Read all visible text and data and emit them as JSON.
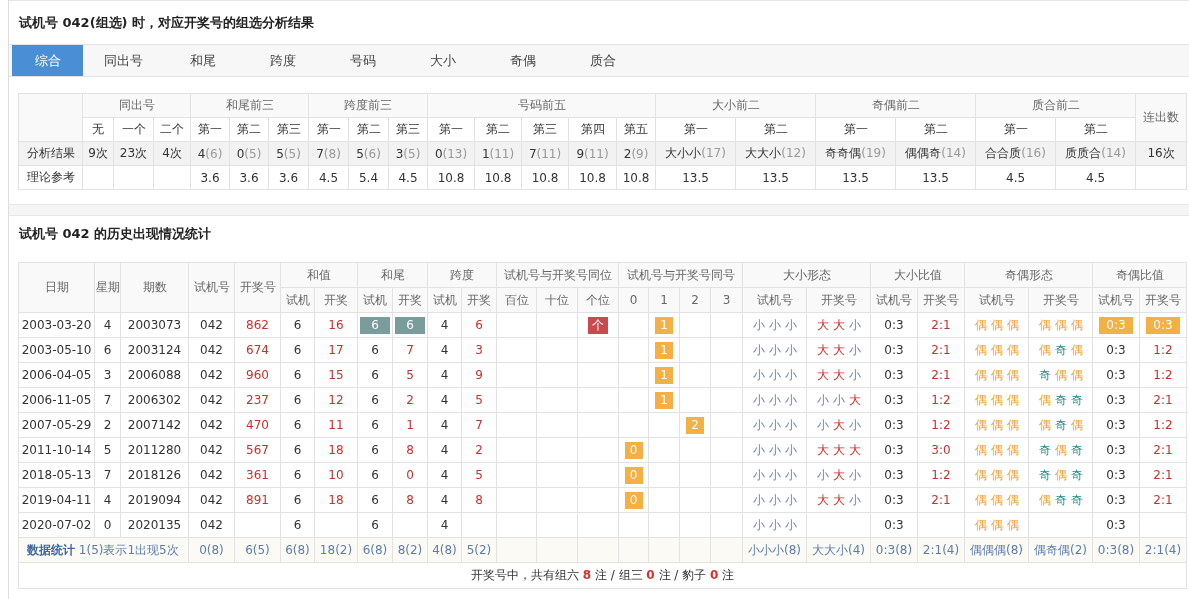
{
  "title": "试机号 042(组选) 时，对应开奖号的组选分析结果",
  "tabs": [
    {
      "label": "综合",
      "selected": true
    },
    {
      "label": "同出号",
      "selected": false
    },
    {
      "label": "和尾",
      "selected": false
    },
    {
      "label": "跨度",
      "selected": false
    },
    {
      "label": "号码",
      "selected": false
    },
    {
      "label": "大小",
      "selected": false
    },
    {
      "label": "奇偶",
      "selected": false
    },
    {
      "label": "质合",
      "selected": false
    }
  ],
  "summary": {
    "row_labels": [
      "分析结果",
      "理论参考"
    ],
    "groups": [
      {
        "title": "同出号",
        "subs": [
          "无",
          "一个",
          "二个"
        ],
        "result": [
          {
            "value": "9次"
          },
          {
            "value": "23次"
          },
          {
            "value": "4次"
          }
        ]
      },
      {
        "title": "和尾前三",
        "subs": [
          "第一",
          "第二",
          "第三"
        ],
        "result": [
          {
            "value": "4",
            "count": "(6)"
          },
          {
            "value": "0",
            "count": "(5)"
          },
          {
            "value": "5",
            "count": "(5)"
          }
        ],
        "theory": [
          "3.6",
          "3.6",
          "3.6"
        ]
      },
      {
        "title": "跨度前三",
        "subs": [
          "第一",
          "第二",
          "第三"
        ],
        "result": [
          {
            "value": "7",
            "count": "(8)"
          },
          {
            "value": "5",
            "count": "(6)"
          },
          {
            "value": "3",
            "count": "(5)"
          }
        ],
        "theory": [
          "4.5",
          "5.4",
          "4.5"
        ]
      },
      {
        "title": "号码前五",
        "subs": [
          "第一",
          "第二",
          "第三",
          "第四",
          "第五"
        ],
        "result": [
          {
            "value": "0",
            "count": "(13)"
          },
          {
            "value": "1",
            "count": "(11)"
          },
          {
            "value": "7",
            "count": "(11)"
          },
          {
            "value": "9",
            "count": "(11)"
          },
          {
            "value": "2",
            "count": "(9)"
          }
        ],
        "theory": [
          "10.8",
          "10.8",
          "10.8",
          "10.8",
          "10.8"
        ]
      },
      {
        "title": "大小前二",
        "subs": [
          "第一",
          "第二"
        ],
        "result": [
          {
            "value": "大小小",
            "count": "(17)"
          },
          {
            "value": "大大小",
            "count": "(12)"
          }
        ],
        "theory": [
          "13.5",
          "13.5"
        ]
      },
      {
        "title": "奇偶前二",
        "subs": [
          "第一",
          "第二"
        ],
        "result": [
          {
            "value": "奇奇偶",
            "count": "(19)"
          },
          {
            "value": "偶偶奇",
            "count": "(14)"
          }
        ],
        "theory": [
          "13.5",
          "13.5"
        ]
      },
      {
        "title": "质合前二",
        "subs": [
          "第一",
          "第二"
        ],
        "result": [
          {
            "value": "合合质",
            "count": "(16)"
          },
          {
            "value": "质质合",
            "count": "(14)"
          }
        ],
        "theory": [
          "4.5",
          "4.5"
        ]
      },
      {
        "title": "连出数",
        "result": [
          {
            "value": "16次"
          }
        ]
      }
    ]
  },
  "history": {
    "title": "试机号 042 的历史出现情况统计",
    "head": {
      "date": "日期",
      "weekday": "星期",
      "issue": "期数",
      "test": "试机号",
      "draw": "开奖号",
      "groups": [
        {
          "title": "和值",
          "subs": [
            "试机",
            "开奖"
          ]
        },
        {
          "title": "和尾",
          "subs": [
            "试机",
            "开奖"
          ]
        },
        {
          "title": "跨度",
          "subs": [
            "试机",
            "开奖"
          ]
        },
        {
          "title": "试机号与开奖号同位",
          "subs": [
            "百位",
            "十位",
            "个位"
          ]
        },
        {
          "title": "试机号与开奖号同号",
          "subs": [
            "0",
            "1",
            "2",
            "3"
          ]
        },
        {
          "title": "大小形态",
          "subs": [
            "试机号",
            "开奖号"
          ]
        },
        {
          "title": "大小比值",
          "subs": [
            "试机号",
            "开奖号"
          ]
        },
        {
          "title": "奇偶形态",
          "subs": [
            "试机号",
            "开奖号"
          ]
        },
        {
          "title": "奇偶比值",
          "subs": [
            "试机号",
            "开奖号"
          ]
        }
      ]
    },
    "rows": [
      {
        "date": "2003-03-20",
        "weekday": "4",
        "issue": "2003073",
        "test": "042",
        "draw": "862",
        "sum_test": "6",
        "sum_draw": "16",
        "tail_test": "6",
        "tail_draw": "6",
        "tail_match": true,
        "span_test": "4",
        "span_draw": "6",
        "same_pos": {
          "ones": "个"
        },
        "same_num": {
          "one": "1"
        },
        "bs_test": [
          {
            "char": "小",
            "kind": "small"
          },
          {
            "char": "小",
            "kind": "small"
          },
          {
            "char": "小",
            "kind": "small"
          }
        ],
        "bs_draw": [
          {
            "char": "大",
            "kind": "big"
          },
          {
            "char": "大",
            "kind": "big"
          },
          {
            "char": "小",
            "kind": "small"
          }
        ],
        "bs_ratio_test": "0:3",
        "bs_ratio_draw": "2:1",
        "oe_test": [
          {
            "char": "偶",
            "kind": "even"
          },
          {
            "char": "偶",
            "kind": "even"
          },
          {
            "char": "偶",
            "kind": "even"
          }
        ],
        "oe_draw": [
          {
            "char": "偶",
            "kind": "even"
          },
          {
            "char": "偶",
            "kind": "even"
          },
          {
            "char": "偶",
            "kind": "even"
          }
        ],
        "oe_ratio_test": "0:3",
        "oe_ratio_draw": "0:3",
        "oe_ratio_match": true
      },
      {
        "date": "2003-05-10",
        "weekday": "6",
        "issue": "2003124",
        "test": "042",
        "draw": "674",
        "sum_test": "6",
        "sum_draw": "17",
        "tail_test": "6",
        "tail_draw": "7",
        "tail_match": false,
        "span_test": "4",
        "span_draw": "3",
        "same_num": {
          "one": "1"
        },
        "bs_test": [
          {
            "char": "小",
            "kind": "small"
          },
          {
            "char": "小",
            "kind": "small"
          },
          {
            "char": "小",
            "kind": "small"
          }
        ],
        "bs_draw": [
          {
            "char": "大",
            "kind": "big"
          },
          {
            "char": "大",
            "kind": "big"
          },
          {
            "char": "小",
            "kind": "small"
          }
        ],
        "bs_ratio_test": "0:3",
        "bs_ratio_draw": "2:1",
        "oe_test": [
          {
            "char": "偶",
            "kind": "even"
          },
          {
            "char": "偶",
            "kind": "even"
          },
          {
            "char": "偶",
            "kind": "even"
          }
        ],
        "oe_draw": [
          {
            "char": "偶",
            "kind": "even"
          },
          {
            "char": "奇",
            "kind": "odd"
          },
          {
            "char": "偶",
            "kind": "even"
          }
        ],
        "oe_ratio_test": "0:3",
        "oe_ratio_draw": "1:2",
        "oe_ratio_match": false
      },
      {
        "date": "2006-04-05",
        "weekday": "3",
        "issue": "2006088",
        "test": "042",
        "draw": "960",
        "sum_test": "6",
        "sum_draw": "15",
        "tail_test": "6",
        "tail_draw": "5",
        "tail_match": false,
        "span_test": "4",
        "span_draw": "9",
        "same_num": {
          "one": "1"
        },
        "bs_test": [
          {
            "char": "小",
            "kind": "small"
          },
          {
            "char": "小",
            "kind": "small"
          },
          {
            "char": "小",
            "kind": "small"
          }
        ],
        "bs_draw": [
          {
            "char": "大",
            "kind": "big"
          },
          {
            "char": "大",
            "kind": "big"
          },
          {
            "char": "小",
            "kind": "small"
          }
        ],
        "bs_ratio_test": "0:3",
        "bs_ratio_draw": "2:1",
        "oe_test": [
          {
            "char": "偶",
            "kind": "even"
          },
          {
            "char": "偶",
            "kind": "even"
          },
          {
            "char": "偶",
            "kind": "even"
          }
        ],
        "oe_draw": [
          {
            "char": "奇",
            "kind": "odd"
          },
          {
            "char": "偶",
            "kind": "even"
          },
          {
            "char": "偶",
            "kind": "even"
          }
        ],
        "oe_ratio_test": "0:3",
        "oe_ratio_draw": "1:2",
        "oe_ratio_match": false
      },
      {
        "date": "2006-11-05",
        "weekday": "7",
        "issue": "2006302",
        "test": "042",
        "draw": "237",
        "sum_test": "6",
        "sum_draw": "12",
        "tail_test": "6",
        "tail_draw": "2",
        "tail_match": false,
        "span_test": "4",
        "span_draw": "5",
        "same_num": {
          "one": "1"
        },
        "bs_test": [
          {
            "char": "小",
            "kind": "small"
          },
          {
            "char": "小",
            "kind": "small"
          },
          {
            "char": "小",
            "kind": "small"
          }
        ],
        "bs_draw": [
          {
            "char": "小",
            "kind": "small"
          },
          {
            "char": "小",
            "kind": "small"
          },
          {
            "char": "大",
            "kind": "big"
          }
        ],
        "bs_ratio_test": "0:3",
        "bs_ratio_draw": "1:2",
        "oe_test": [
          {
            "char": "偶",
            "kind": "even"
          },
          {
            "char": "偶",
            "kind": "even"
          },
          {
            "char": "偶",
            "kind": "even"
          }
        ],
        "oe_draw": [
          {
            "char": "偶",
            "kind": "even"
          },
          {
            "char": "奇",
            "kind": "odd"
          },
          {
            "char": "奇",
            "kind": "odd"
          }
        ],
        "oe_ratio_test": "0:3",
        "oe_ratio_draw": "2:1",
        "oe_ratio_match": false
      },
      {
        "date": "2007-05-29",
        "weekday": "2",
        "issue": "2007142",
        "test": "042",
        "draw": "470",
        "sum_test": "6",
        "sum_draw": "11",
        "tail_test": "6",
        "tail_draw": "1",
        "tail_match": false,
        "span_test": "4",
        "span_draw": "7",
        "same_num": {
          "two": "2"
        },
        "bs_test": [
          {
            "char": "小",
            "kind": "small"
          },
          {
            "char": "小",
            "kind": "small"
          },
          {
            "char": "小",
            "kind": "small"
          }
        ],
        "bs_draw": [
          {
            "char": "小",
            "kind": "small"
          },
          {
            "char": "大",
            "kind": "big"
          },
          {
            "char": "小",
            "kind": "small"
          }
        ],
        "bs_ratio_test": "0:3",
        "bs_ratio_draw": "1:2",
        "oe_test": [
          {
            "char": "偶",
            "kind": "even"
          },
          {
            "char": "偶",
            "kind": "even"
          },
          {
            "char": "偶",
            "kind": "even"
          }
        ],
        "oe_draw": [
          {
            "char": "偶",
            "kind": "even"
          },
          {
            "char": "奇",
            "kind": "odd"
          },
          {
            "char": "偶",
            "kind": "even"
          }
        ],
        "oe_ratio_test": "0:3",
        "oe_ratio_draw": "1:2",
        "oe_ratio_match": false
      },
      {
        "date": "2011-10-14",
        "weekday": "5",
        "issue": "2011280",
        "test": "042",
        "draw": "567",
        "sum_test": "6",
        "sum_draw": "18",
        "tail_test": "6",
        "tail_draw": "8",
        "tail_match": false,
        "span_test": "4",
        "span_draw": "2",
        "same_num": {
          "zero": "0"
        },
        "bs_test": [
          {
            "char": "小",
            "kind": "small"
          },
          {
            "char": "小",
            "kind": "small"
          },
          {
            "char": "小",
            "kind": "small"
          }
        ],
        "bs_draw": [
          {
            "char": "大",
            "kind": "big"
          },
          {
            "char": "大",
            "kind": "big"
          },
          {
            "char": "大",
            "kind": "big"
          }
        ],
        "bs_ratio_test": "0:3",
        "bs_ratio_draw": "3:0",
        "oe_test": [
          {
            "char": "偶",
            "kind": "even"
          },
          {
            "char": "偶",
            "kind": "even"
          },
          {
            "char": "偶",
            "kind": "even"
          }
        ],
        "oe_draw": [
          {
            "char": "奇",
            "kind": "odd"
          },
          {
            "char": "偶",
            "kind": "even"
          },
          {
            "char": "奇",
            "kind": "odd"
          }
        ],
        "oe_ratio_test": "0:3",
        "oe_ratio_draw": "2:1",
        "oe_ratio_match": false
      },
      {
        "date": "2018-05-13",
        "weekday": "7",
        "issue": "2018126",
        "test": "042",
        "draw": "361",
        "sum_test": "6",
        "sum_draw": "10",
        "tail_test": "6",
        "tail_draw": "0",
        "tail_match": false,
        "span_test": "4",
        "span_draw": "5",
        "same_num": {
          "zero": "0"
        },
        "bs_test": [
          {
            "char": "小",
            "kind": "small"
          },
          {
            "char": "小",
            "kind": "small"
          },
          {
            "char": "小",
            "kind": "small"
          }
        ],
        "bs_draw": [
          {
            "char": "小",
            "kind": "small"
          },
          {
            "char": "大",
            "kind": "big"
          },
          {
            "char": "小",
            "kind": "small"
          }
        ],
        "bs_ratio_test": "0:3",
        "bs_ratio_draw": "1:2",
        "oe_test": [
          {
            "char": "偶",
            "kind": "even"
          },
          {
            "char": "偶",
            "kind": "even"
          },
          {
            "char": "偶",
            "kind": "even"
          }
        ],
        "oe_draw": [
          {
            "char": "奇",
            "kind": "odd"
          },
          {
            "char": "偶",
            "kind": "even"
          },
          {
            "char": "奇",
            "kind": "odd"
          }
        ],
        "oe_ratio_test": "0:3",
        "oe_ratio_draw": "2:1",
        "oe_ratio_match": false
      },
      {
        "date": "2019-04-11",
        "weekday": "4",
        "issue": "2019094",
        "test": "042",
        "draw": "891",
        "sum_test": "6",
        "sum_draw": "18",
        "tail_test": "6",
        "tail_draw": "8",
        "tail_match": false,
        "span_test": "4",
        "span_draw": "8",
        "same_num": {
          "zero": "0"
        },
        "bs_test": [
          {
            "char": "小",
            "kind": "small"
          },
          {
            "char": "小",
            "kind": "small"
          },
          {
            "char": "小",
            "kind": "small"
          }
        ],
        "bs_draw": [
          {
            "char": "大",
            "kind": "big"
          },
          {
            "char": "大",
            "kind": "big"
          },
          {
            "char": "小",
            "kind": "small"
          }
        ],
        "bs_ratio_test": "0:3",
        "bs_ratio_draw": "2:1",
        "oe_test": [
          {
            "char": "偶",
            "kind": "even"
          },
          {
            "char": "偶",
            "kind": "even"
          },
          {
            "char": "偶",
            "kind": "even"
          }
        ],
        "oe_draw": [
          {
            "char": "偶",
            "kind": "even"
          },
          {
            "char": "奇",
            "kind": "odd"
          },
          {
            "char": "奇",
            "kind": "odd"
          }
        ],
        "oe_ratio_test": "0:3",
        "oe_ratio_draw": "2:1",
        "oe_ratio_match": false
      },
      {
        "date": "2020-07-02",
        "weekday": "0",
        "issue": "2020135",
        "test": "042",
        "sum_test": "6",
        "tail_test": "6",
        "tail_match": false,
        "span_test": "4",
        "bs_test": [
          {
            "char": "小",
            "kind": "small"
          },
          {
            "char": "小",
            "kind": "small"
          },
          {
            "char": "小",
            "kind": "small"
          }
        ],
        "bs_ratio_test": "0:3",
        "oe_test": [
          {
            "char": "偶",
            "kind": "even"
          },
          {
            "char": "偶",
            "kind": "even"
          },
          {
            "char": "偶",
            "kind": "even"
          }
        ],
        "oe_ratio_test": "0:3",
        "oe_ratio_match": false
      }
    ],
    "footer": {
      "note": "**数据统计** 1(5)表示1出现5次",
      "test": "0(8)",
      "draw": "6(5)",
      "sum": [
        "6(8)",
        "18(2)"
      ],
      "tail": [
        "6(8)",
        "8(2)"
      ],
      "span": [
        "4(8)",
        "5(2)"
      ],
      "bs_form": [
        "小小小(8)",
        "大大小(4)"
      ],
      "bs_ratio": [
        "0:3(8)",
        "2:1(4)"
      ],
      "oe_form": [
        "偶偶偶(8)",
        "偶奇偶(2)"
      ],
      "oe_ratio": [
        "0:3(8)",
        "2:1(4)"
      ]
    },
    "summary_line": "开奖号中，共有组六 **8** 注 / 组三 **0** 注 / 豹子 **0** 注"
  }
}
